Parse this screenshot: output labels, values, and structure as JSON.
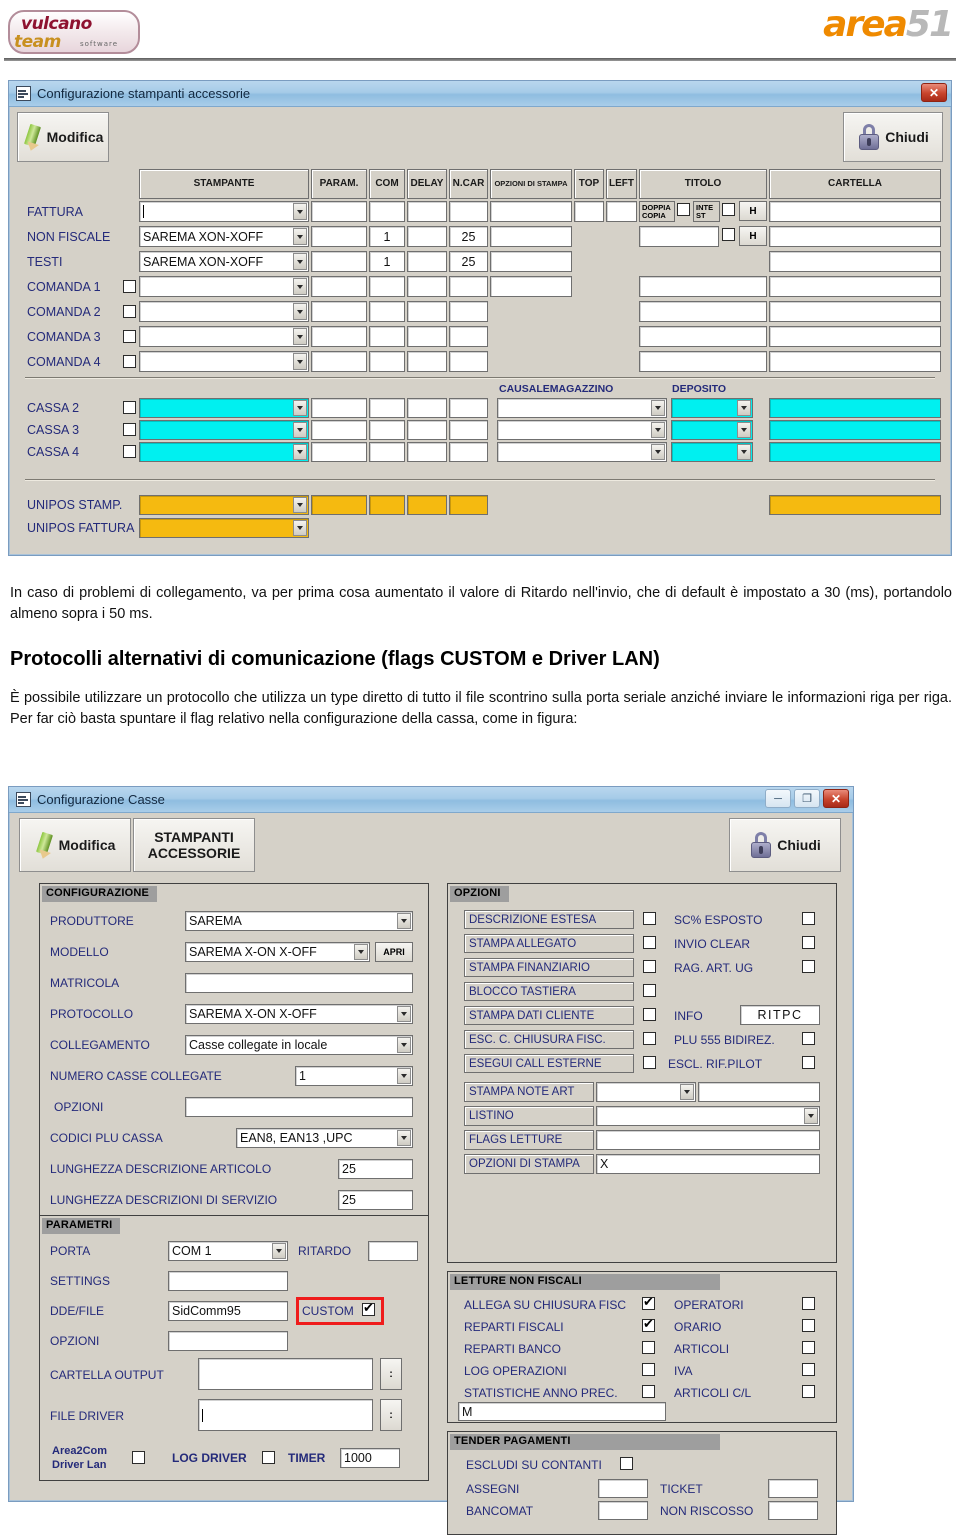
{
  "page": {
    "logo_left_line1": "vulcano",
    "logo_left_line2": "team",
    "logo_left_sub": "software",
    "logo_right_word": "area",
    "logo_right_num": "51"
  },
  "body_text": {
    "para1": "In caso di problemi di collegamento, va per prima cosa aumentato il valore di Ritardo nell'invio, che di default è impostato a 30 (ms), portandolo almeno sopra i 50 ms.",
    "heading": "Protocolli alternativi di comunicazione (flags CUSTOM e Driver LAN)",
    "para2": "È possibile utilizzare un protocollo che utilizza un type diretto di tutto il file scontrino sulla porta seriale anziché inviare le informazioni riga per riga. Per far ciò basta spuntare il flag relativo nella configurazione della cassa, come in figura:"
  },
  "win1": {
    "title": "Configurazione stampanti accessorie",
    "close_label": "✕",
    "toolbar": {
      "modifica": "Modifica",
      "chiudi": "Chiudi"
    },
    "headers": [
      "STAMPANTE",
      "PARAM.",
      "COM",
      "DELAY",
      "N.CAR",
      "OPZIONI DI STAMPA",
      "TOP",
      "LEFT",
      "TITOLO",
      "CARTELLA"
    ],
    "rows": [
      {
        "label": "FATTURA",
        "has_check": false,
        "printer": "",
        "param": "",
        "com": "",
        "delay": "",
        "ncar": "",
        "opzioni": "",
        "top": "",
        "left": "",
        "cartella": ""
      },
      {
        "label": "NON FISCALE",
        "has_check": false,
        "printer": "SAREMA XON-XOFF",
        "param": "",
        "com": "1",
        "delay": "",
        "ncar": "25",
        "opzioni": "",
        "top": "",
        "left": "",
        "cartella": ""
      },
      {
        "label": "TESTI",
        "has_check": false,
        "printer": "SAREMA XON-XOFF",
        "param": "",
        "com": "1",
        "delay": "",
        "ncar": "25",
        "opzioni": "",
        "top": "",
        "left": "",
        "cartella": ""
      },
      {
        "label": "COMANDA 1",
        "has_check": true,
        "printer": "",
        "param": "",
        "com": "",
        "delay": "",
        "ncar": "",
        "opzioni": "",
        "titolo": "",
        "cartella": ""
      },
      {
        "label": "COMANDA 2",
        "has_check": true,
        "printer": "",
        "param": "",
        "com": "",
        "delay": "",
        "ncar": "",
        "titolo": "",
        "cartella": ""
      },
      {
        "label": "COMANDA 3",
        "has_check": true,
        "printer": "",
        "param": "",
        "com": "",
        "delay": "",
        "ncar": "",
        "titolo": "",
        "cartella": ""
      },
      {
        "label": "COMANDA 4",
        "has_check": true,
        "printer": "",
        "param": "",
        "com": "",
        "delay": "",
        "ncar": "",
        "titolo": "",
        "cartella": ""
      }
    ],
    "titolo_extra": {
      "doppia_copia": "DOPPIA COPIA",
      "intest": "INTE ST",
      "h_button": "H"
    },
    "cassa_caps": {
      "causale": "CAUSALEMAGAZZINO",
      "deposito": "DEPOSITO"
    },
    "cassa_rows": [
      {
        "label": "CASSA 2",
        "printer": "",
        "param": "",
        "com": "",
        "delay": "",
        "ncar": "",
        "causale": "",
        "deposito": "",
        "cartella": ""
      },
      {
        "label": "CASSA 3",
        "printer": "",
        "param": "",
        "com": "",
        "delay": "",
        "ncar": "",
        "causale": "",
        "deposito": "",
        "cartella": ""
      },
      {
        "label": "CASSA 4",
        "printer": "",
        "param": "",
        "com": "",
        "delay": "",
        "ncar": "",
        "causale": "",
        "deposito": "",
        "cartella": ""
      }
    ],
    "unipos_rows": [
      {
        "label": "UNIPOS STAMP.",
        "printer": "",
        "f1": "",
        "f2": "",
        "f3": "",
        "f4": "",
        "cartella": ""
      },
      {
        "label": "UNIPOS FATTURA",
        "printer": ""
      }
    ],
    "colors": {
      "cyan": "#00f0f0",
      "gold": "#f5ba10"
    }
  },
  "win2": {
    "title": "Configurazione Casse",
    "min_label": "─",
    "max_label": "❐",
    "close_label": "✕",
    "toolbar": {
      "modifica": "Modifica",
      "stampanti_l1": "STAMPANTI",
      "stampanti_l2": "ACCESSORIE",
      "chiudi": "Chiudi"
    },
    "configurazione": {
      "caption": "CONFIGURAZIONE",
      "fields": [
        {
          "label": "PRODUTTORE",
          "value": "SAREMA"
        },
        {
          "label": "MODELLO",
          "value": "SAREMA X-ON X-OFF",
          "button": "APRI"
        },
        {
          "label": "MATRICOLA",
          "value": ""
        },
        {
          "label": "PROTOCOLLO",
          "value": "SAREMA X-ON X-OFF"
        },
        {
          "label": "COLLEGAMENTO",
          "value": "Casse collegate in locale"
        },
        {
          "label": "NUMERO CASSE COLLEGATE",
          "value": "1"
        },
        {
          "label": "OPZIONI",
          "value": ""
        },
        {
          "label": "CODICI PLU CASSA",
          "value": "EAN8, EAN13 ,UPC"
        },
        {
          "label": "LUNGHEZZA DESCRIZIONE ARTICOLO",
          "value": "25"
        },
        {
          "label": "LUNGHEZZA DESCRIZIONI DI SERVIZIO",
          "value": "25"
        }
      ]
    },
    "parametri": {
      "caption": "PARAMETRI",
      "porta_label": "PORTA",
      "porta_value": "COM 1",
      "ritardo_label": "RITARDO",
      "ritardo_value": "",
      "settings_label": "SETTINGS",
      "settings_value": "",
      "ddefile_label": "DDE/FILE",
      "ddefile_value": "SidComm95",
      "custom_label": "CUSTOM",
      "custom_checked": true,
      "opzioni_label": "OPZIONI",
      "opzioni_value": "",
      "cartella_output_label": "CARTELLA OUTPUT",
      "cartella_output_value": "",
      "file_driver_label": "FILE DRIVER",
      "file_driver_value": "",
      "browse_label": ":",
      "area2com_l1": "Area2Com",
      "area2com_l2": "Driver Lan",
      "area2com_checked": false,
      "log_driver_label": "LOG DRIVER",
      "log_driver_checked": false,
      "timer_label": "TIMER",
      "timer_value": "1000"
    },
    "opzioni": {
      "caption": "OPZIONI",
      "left_checks": [
        {
          "label": "DESCRIZIONE ESTESA",
          "checked": false
        },
        {
          "label": "STAMPA ALLEGATO",
          "checked": false
        },
        {
          "label": "STAMPA FINANZIARIO",
          "checked": false
        },
        {
          "label": "BLOCCO TASTIERA",
          "checked": false
        },
        {
          "label": "STAMPA DATI CLIENTE",
          "checked": false
        },
        {
          "label": "ESC. C. CHIUSURA FISC.",
          "checked": false
        },
        {
          "label": "ESEGUI CALL ESTERNE",
          "checked": false
        }
      ],
      "right_checks": [
        {
          "label": "SC% ESPOSTO",
          "checked": false
        },
        {
          "label": "INVIO CLEAR",
          "checked": false
        },
        {
          "label": "RAG. ART. UG",
          "checked": false
        },
        {
          "label": "",
          "checked": null
        },
        {
          "label": "INFO",
          "value": "RITPC"
        },
        {
          "label": "PLU 555 BIDIREZ.",
          "checked": false
        },
        {
          "label": "ESCL. RIF.PILOT",
          "checked": false
        }
      ],
      "rows": [
        {
          "label": "STAMPA NOTE ART",
          "value": "",
          "value2": ""
        },
        {
          "label": "LISTINO",
          "value": ""
        },
        {
          "label": "FLAGS LETTURE",
          "value": ""
        },
        {
          "label": "OPZIONI DI STAMPA",
          "value": "X"
        }
      ]
    },
    "letture": {
      "caption": "LETTURE NON FISCALI",
      "left": [
        {
          "label": "ALLEGA SU CHIUSURA FISC",
          "checked": true
        },
        {
          "label": "REPARTI FISCALI",
          "checked": true
        },
        {
          "label": "REPARTI BANCO",
          "checked": false
        },
        {
          "label": "LOG OPERAZIONI",
          "checked": false
        },
        {
          "label": "STATISTICHE ANNO PREC.",
          "checked": false
        }
      ],
      "right": [
        {
          "label": "OPERATORI",
          "checked": false
        },
        {
          "label": "ORARIO",
          "checked": false
        },
        {
          "label": "ARTICOLI",
          "checked": false
        },
        {
          "label": "IVA",
          "checked": false
        },
        {
          "label": "ARTICOLI C/L",
          "checked": false
        }
      ],
      "text_value": "M"
    },
    "tender": {
      "caption": "TENDER PAGAMENTI",
      "escludi_label": "ESCLUDI SU CONTANTI",
      "escludi_checked": false,
      "rows": [
        {
          "label": "ASSEGNI",
          "value": "",
          "label2": "TICKET",
          "value2": ""
        },
        {
          "label": "BANCOMAT",
          "value": "",
          "label2": "NON RISCOSSO",
          "value2": ""
        }
      ]
    }
  }
}
